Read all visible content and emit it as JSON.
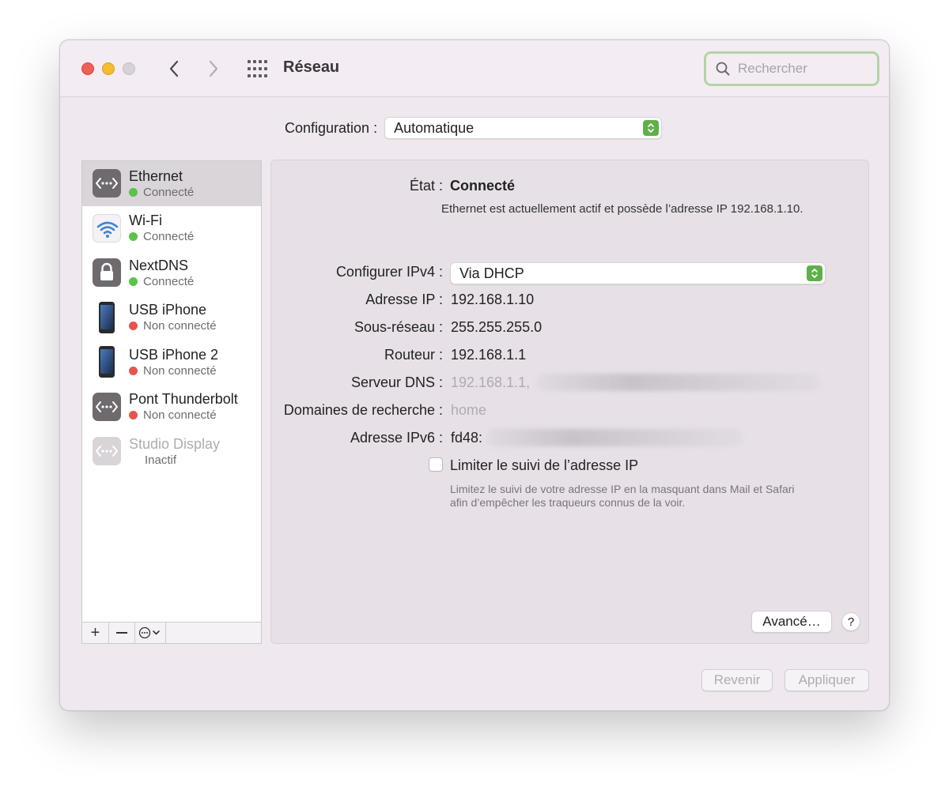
{
  "window": {
    "title": "Réseau",
    "search_placeholder": "Rechercher"
  },
  "configuration": {
    "label": "Configuration :",
    "value": "Automatique"
  },
  "services": [
    {
      "name": "Ethernet",
      "status": "Connecté",
      "status_color": "#5bc24b",
      "icon": "ethernet-icon",
      "selected": true
    },
    {
      "name": "Wi-Fi",
      "status": "Connecté",
      "status_color": "#5bc24b",
      "icon": "wifi-icon"
    },
    {
      "name": "NextDNS",
      "status": "Connecté",
      "status_color": "#5bc24b",
      "icon": "lock-icon"
    },
    {
      "name": "USB iPhone",
      "status": "Non connecté",
      "status_color": "#e5554f",
      "icon": "iphone-icon"
    },
    {
      "name": "USB iPhone 2",
      "status": "Non connecté",
      "status_color": "#e5554f",
      "icon": "iphone-icon"
    },
    {
      "name": "Pont Thunderbolt",
      "status": "Non connecté",
      "status_color": "#e5554f",
      "icon": "ethernet-icon"
    },
    {
      "name": "Studio Display",
      "status": "Inactif",
      "icon": "ethernet-icon",
      "inactive": true
    }
  ],
  "sidebar_toolbar": {
    "add": "+",
    "remove": "—"
  },
  "detail": {
    "state_label": "État :",
    "state_value": "Connecté",
    "state_description": "Ethernet est actuellement actif et possède l’adresse IP 192.168.1.10.",
    "ipv4_label": "Configurer IPv4 :",
    "ipv4_value": "Via DHCP",
    "ip_label": "Adresse IP :",
    "ip_value": "192.168.1.10",
    "subnet_label": "Sous-réseau :",
    "subnet_value": "255.255.255.0",
    "router_label": "Routeur :",
    "router_value": "192.168.1.1",
    "dns_label": "Serveur DNS :",
    "dns_value": "192.168.1.1,",
    "search_domains_label": "Domaines de recherche :",
    "search_domains_value": "home",
    "ipv6_label": "Adresse IPv6 :",
    "ipv6_value": "fd48:",
    "limit_tracking_label": "Limiter le suivi de l’adresse IP",
    "limit_tracking_checked": false,
    "limit_tracking_hint_line1": "Limitez le suivi de votre adresse IP en la masquant dans Mail et Safari",
    "limit_tracking_hint_line2": "afin d’empêcher les traqueurs connus de la voir.",
    "advanced_button": "Avancé…",
    "help_button": "?"
  },
  "footer": {
    "revert_button": "Revenir",
    "apply_button": "Appliquer"
  },
  "colors": {
    "accent_green": "#5fb04a",
    "status_connected": "#5bc24b",
    "status_disconnected": "#e5554f",
    "search_focus_ring": "#b5d3a5"
  }
}
